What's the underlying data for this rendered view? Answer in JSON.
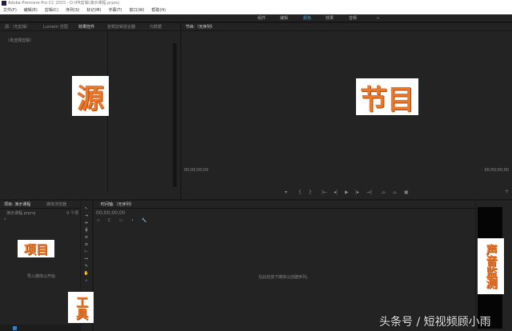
{
  "title": "Adobe Premiere Pro CC 2015 - D:\\PR剪辑\\演示课程.prproj",
  "menu": [
    "文件(F)",
    "编辑(E)",
    "剪辑(C)",
    "序列(S)",
    "标记(M)",
    "字幕(T)",
    "窗口(W)",
    "帮助(H)"
  ],
  "workspaces": {
    "items": [
      "组件",
      "编辑",
      "颜色",
      "效果",
      "音频"
    ],
    "active": "颜色",
    "more": "»"
  },
  "source_panel": {
    "tabs": [
      "源:（无剪辑）",
      "Lumetri 范围",
      "效果控件",
      "音频剪辑混合器",
      "元数据"
    ],
    "active_tab": "效果控件",
    "empty_text": "（未选择剪辑）"
  },
  "program_panel": {
    "tab": "节目:（无序列）",
    "timecode_left": "00;00;00;00",
    "timecode_right": "00;00;00;00"
  },
  "project_panel": {
    "tabs": [
      "项目: 演示课程",
      "媒体浏览器"
    ],
    "file": "演示课程.prproj",
    "item_count": "0 个项",
    "empty_text": "导入媒体以开始"
  },
  "timeline_panel": {
    "tab": "时间轴:（无序列）",
    "timecode": "00;00;00;00",
    "empty_text": "在此处放下媒体以创建序列。"
  },
  "annotations": {
    "source": "源",
    "program": "节目",
    "project": "项目",
    "tools": "工具",
    "audio": "声音监测"
  },
  "watermark": "头条号 / 短视频顾小雨",
  "colors": {
    "accent": "#4aa3d8",
    "label_text": "#e8782a",
    "panel_bg": "#232323"
  }
}
